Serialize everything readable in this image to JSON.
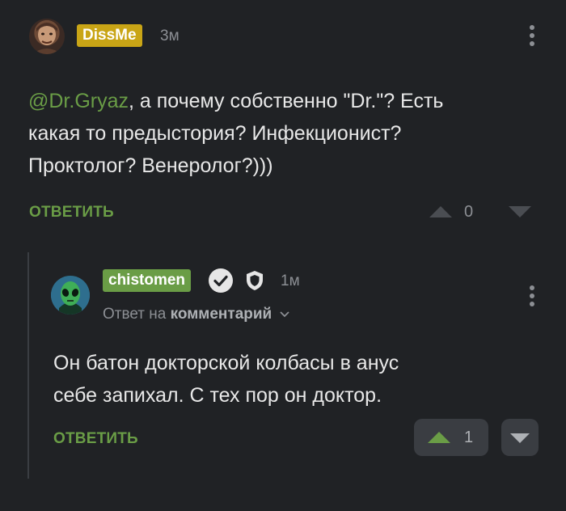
{
  "comment": {
    "username": "DissMe",
    "time": "3м",
    "mention": "@Dr.Gryaz",
    "text_line1_rest": ", а почему собственно \"Dr.\"? Есть",
    "text_line2": "какая то предыстория? Инфекционист?",
    "text_line3": "Проктолог? Венеролог?)))",
    "reply_label": "ОТВЕТИТЬ",
    "votes": "0"
  },
  "reply": {
    "username": "chistomen",
    "time": "1м",
    "meta_prefix": "Ответ на",
    "meta_link": "комментарий",
    "text_line1": "Он батон докторской колбасы в анус",
    "text_line2": "себе запихал. С тех пор он доктор.",
    "reply_label": "ОТВЕТИТЬ",
    "votes": "1"
  },
  "colors": {
    "background": "#202225",
    "accent_green": "#6a9d46",
    "badge_yellow": "#c9a516",
    "muted": "#8c8f94"
  }
}
